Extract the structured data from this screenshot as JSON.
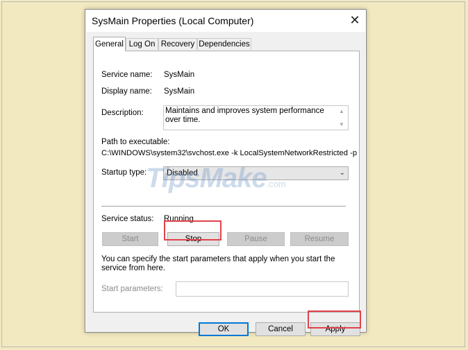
{
  "window": {
    "title": "SysMain Properties (Local Computer)",
    "close_glyph": "✕"
  },
  "tabs": [
    {
      "label": "General",
      "active": true
    },
    {
      "label": "Log On",
      "active": false
    },
    {
      "label": "Recovery",
      "active": false
    },
    {
      "label": "Dependencies",
      "active": false
    }
  ],
  "general": {
    "service_name_label": "Service name:",
    "service_name_value": "SysMain",
    "display_name_label": "Display name:",
    "display_name_value": "SysMain",
    "description_label": "Description:",
    "description_value": "Maintains and improves system performance over time.",
    "path_label": "Path to executable:",
    "path_value": "C:\\WINDOWS\\system32\\svchost.exe -k LocalSystemNetworkRestricted -p",
    "startup_type_label": "Startup type:",
    "startup_type_value": "Disabled",
    "service_status_label": "Service status:",
    "service_status_value": "Running",
    "buttons": {
      "start": "Start",
      "stop": "Stop",
      "pause": "Pause",
      "resume": "Resume"
    },
    "params_hint": "You can specify the start parameters that apply when you start the service from here.",
    "start_params_label": "Start parameters:",
    "start_params_value": ""
  },
  "footer": {
    "ok": "OK",
    "cancel": "Cancel",
    "apply": "Apply"
  },
  "watermark": {
    "brand": "TipsMake",
    "suffix": ".com"
  },
  "colors": {
    "background": "#f2e9c0",
    "highlight": "#e0424a",
    "focus_border": "#0078d7"
  },
  "icons": {
    "dropdown": "chevron-down-icon",
    "scroll_up": "arrow-up-icon",
    "scroll_down": "arrow-down-icon",
    "close": "close-icon"
  }
}
